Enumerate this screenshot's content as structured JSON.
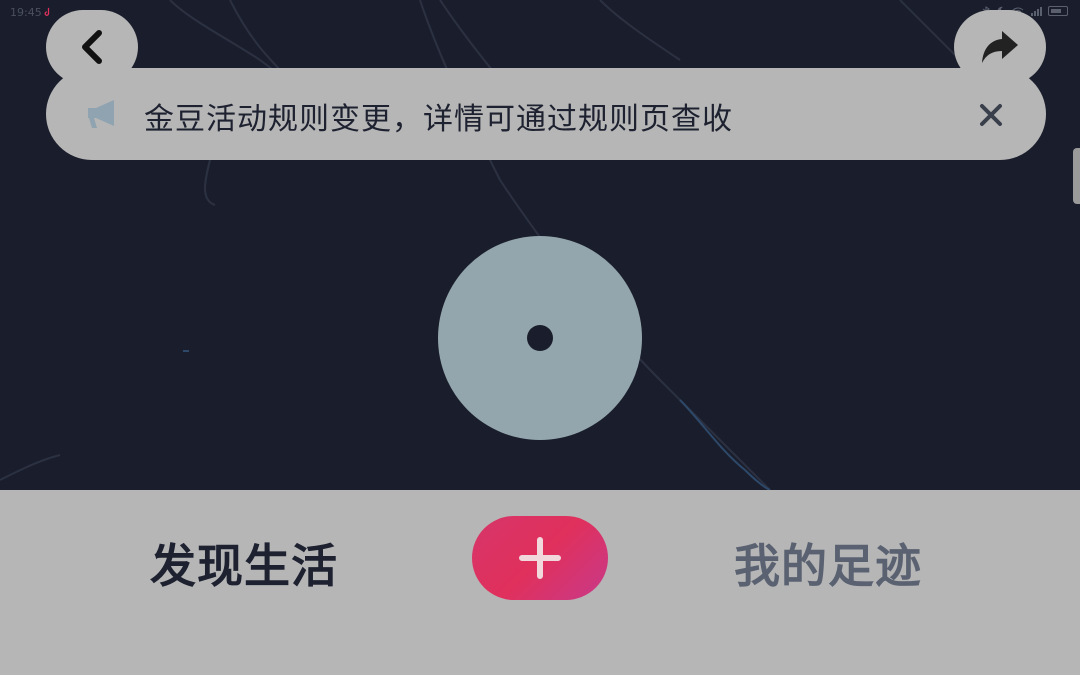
{
  "status_bar": {
    "time": "19:45",
    "icons": [
      "bluetooth-icon",
      "moon-icon",
      "wifi-icon",
      "signal-icon",
      "battery-icon"
    ]
  },
  "top_bar": {
    "back_icon": "chevron-left-icon",
    "share_icon": "share-arrow-icon"
  },
  "notice": {
    "icon": "megaphone-icon",
    "text": "金豆活动规则变更，详情可通过规则页查收",
    "close_icon": "close-icon"
  },
  "map": {
    "marker_color": "#94a6ad",
    "background_color": "#1a1e2c"
  },
  "bottom_nav": {
    "tabs": [
      {
        "label": "发现生活",
        "active": true
      },
      {
        "label": "我的足迹",
        "active": false
      }
    ],
    "add_icon": "plus-icon",
    "add_button_color": "#e0305c"
  }
}
